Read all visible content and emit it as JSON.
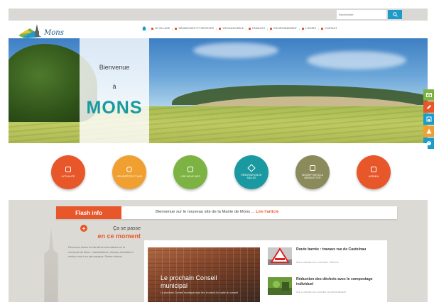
{
  "topbar": {
    "search_placeholder": "Rechercher"
  },
  "header": {
    "logo_text": "Mons",
    "nav": [
      {
        "label": "LE VILLAGE"
      },
      {
        "label": "DÉMARCHES ET SERVICES"
      },
      {
        "label": "VIE MUNICIPALE"
      },
      {
        "label": "FAMILLES"
      },
      {
        "label": "ENVIRONNEMENT"
      },
      {
        "label": "LOISIRS"
      },
      {
        "label": "CONTACT"
      }
    ]
  },
  "hero": {
    "line1": "Bienvenue",
    "line2": "à",
    "title": "MONS"
  },
  "side_tools": [
    {
      "icon": "mail-icon",
      "color": "#7cb342"
    },
    {
      "icon": "pencil-icon",
      "color": "#e8572a"
    },
    {
      "icon": "building-icon",
      "color": "#1d9bc9"
    },
    {
      "icon": "alert-icon",
      "color": "#f0a030"
    },
    {
      "icon": "accessibility-icon",
      "color": "#1d9bc9"
    }
  ],
  "quick_links": [
    {
      "label": "ACTUALITÉ",
      "color": "#e8572a",
      "icon": "newspaper-icon"
    },
    {
      "label": "LES ARRÊTÉS ET AVIS",
      "color": "#f0a030",
      "icon": "document-icon"
    },
    {
      "label": "LIRE MONS INFO",
      "color": "#7cb342",
      "icon": "book-icon"
    },
    {
      "label": "RÉSERVATION DE SALLES",
      "color": "#1a9aa0",
      "icon": "key-icon"
    },
    {
      "label": "INSCRIPTION À LA NEWSLETTER",
      "color": "#8a8a5a",
      "icon": "envelope-icon"
    },
    {
      "label": "AGENDA",
      "color": "#e8572a",
      "icon": "calendar-icon"
    }
  ],
  "flash": {
    "label": "Flash info",
    "text": "Bienvenue sur le nouveau site de la Mairie de Mons ...",
    "link": "Lire l'article"
  },
  "moment": {
    "title1": "Ça se passe",
    "title2": "en ce moment",
    "body": "Découvrez toutes les dernières informations sur la commune de Mons : manifestations, travaux, actualités et rendez-vous à ne pas manquer. Restez informé."
  },
  "news": {
    "featured": {
      "title": "Le prochain Conseil municipal",
      "text": "Le prochain Conseil municipal aura lieu le mardi à la salle du conseil"
    },
    "items": [
      {
        "title": "Route barrée : travaux rue de Castelnau",
        "meta": "PAR LA MAIRIE LE 12 JANVIER | TRAVAUX"
      },
      {
        "title": "Réduction des déchets avec le compostage individuel",
        "meta": "PAR LA MAIRIE LE 8 JANVIER | ENVIRONNEMENT"
      }
    ]
  }
}
